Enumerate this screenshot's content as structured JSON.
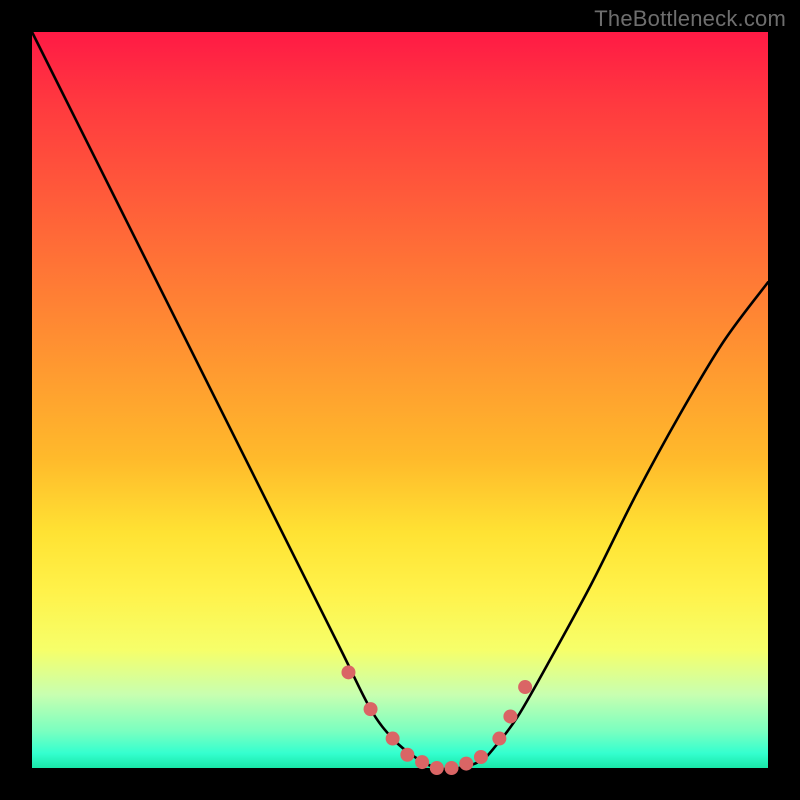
{
  "watermark": "TheBottleneck.com",
  "colors": {
    "frame": "#000000",
    "gradient_top": "#ff1a45",
    "gradient_bottom": "#19e7a8",
    "curve": "#000000",
    "marker": "#da6565"
  },
  "chart_data": {
    "type": "line",
    "title": "",
    "xlabel": "",
    "ylabel": "",
    "xlim": [
      0,
      100
    ],
    "ylim": [
      0,
      100
    ],
    "series": [
      {
        "name": "bottleneck-curve",
        "x": [
          0,
          6,
          12,
          18,
          24,
          30,
          36,
          42,
          46,
          49,
          52,
          55,
          58,
          61,
          63,
          66,
          70,
          76,
          82,
          88,
          94,
          100
        ],
        "y": [
          100,
          88,
          76,
          64,
          52,
          40,
          28,
          16,
          8,
          4,
          1.5,
          0,
          0,
          1,
          3,
          7,
          14,
          25,
          37,
          48,
          58,
          66
        ]
      }
    ],
    "annotations": {
      "markers": [
        {
          "x": 43,
          "y": 13
        },
        {
          "x": 46,
          "y": 8
        },
        {
          "x": 49,
          "y": 4
        },
        {
          "x": 51,
          "y": 1.8
        },
        {
          "x": 53,
          "y": 0.8
        },
        {
          "x": 55,
          "y": 0
        },
        {
          "x": 57,
          "y": 0
        },
        {
          "x": 59,
          "y": 0.6
        },
        {
          "x": 61,
          "y": 1.5
        },
        {
          "x": 63.5,
          "y": 4
        },
        {
          "x": 65,
          "y": 7
        },
        {
          "x": 67,
          "y": 11
        }
      ]
    }
  }
}
